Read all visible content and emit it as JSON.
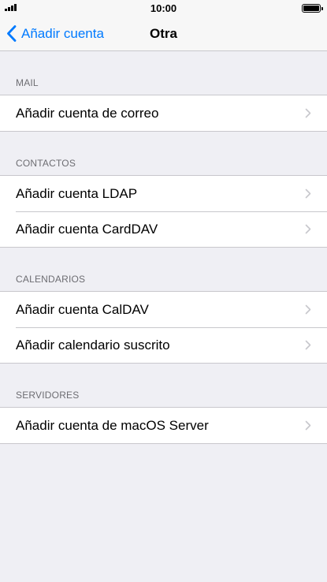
{
  "status_bar": {
    "time": "10:00",
    "battery_level": 1.0,
    "signal_bars": 4
  },
  "nav": {
    "back_label": "Añadir cuenta",
    "title": "Otra"
  },
  "sections": [
    {
      "header": "MAIL",
      "items": [
        "Añadir cuenta de correo"
      ]
    },
    {
      "header": "CONTACTOS",
      "items": [
        "Añadir cuenta LDAP",
        "Añadir cuenta CardDAV"
      ]
    },
    {
      "header": "CALENDARIOS",
      "items": [
        "Añadir cuenta CalDAV",
        "Añadir calendario suscrito"
      ]
    },
    {
      "header": "SERVIDORES",
      "items": [
        "Añadir cuenta de macOS Server"
      ]
    }
  ],
  "icons": {
    "back": "chevron-left-icon",
    "row_disclosure": "chevron-right-icon"
  },
  "colors": {
    "accent": "#007aff",
    "background": "#efeff4",
    "separator": "#c8c7cc",
    "section_header": "#6d6d72",
    "chevron": "#c7c7cc"
  }
}
